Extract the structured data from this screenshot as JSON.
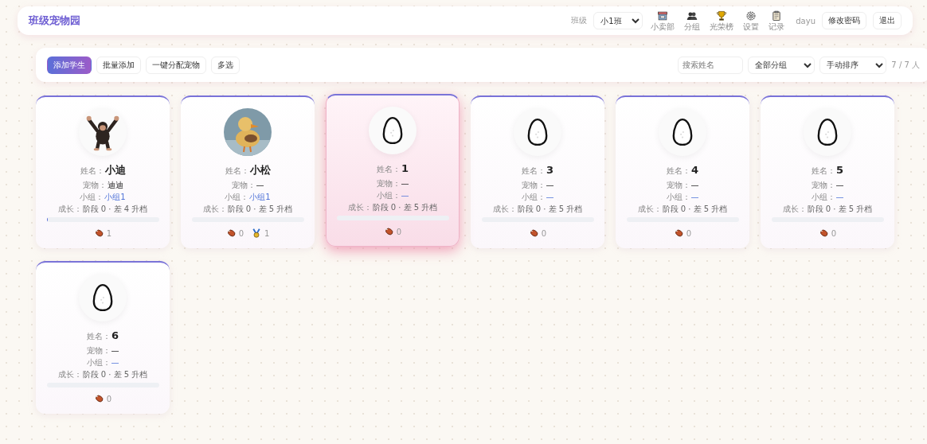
{
  "header": {
    "title": "班级宠物园",
    "class_label": "班级",
    "class_select": "小1班",
    "nav": [
      {
        "label": "小卖部",
        "kind": "store"
      },
      {
        "label": "分组",
        "kind": "people"
      },
      {
        "label": "光荣榜",
        "kind": "trophy"
      },
      {
        "label": "设置",
        "kind": "gear"
      },
      {
        "label": "记录",
        "kind": "clipboard"
      }
    ],
    "user": "dayu",
    "buttons": [
      "修改密码",
      "退出"
    ]
  },
  "toolbar": {
    "buttons": [
      {
        "label": "添加学生",
        "primary": true
      },
      {
        "label": "批量添加",
        "primary": false
      },
      {
        "label": "一键分配宠物",
        "primary": false
      },
      {
        "label": "多选",
        "primary": false
      }
    ],
    "search": {
      "placeholder": "搜索姓名"
    },
    "filters": [
      "全部分组",
      "手动排序"
    ],
    "count": "7 / 7 人"
  },
  "students": [
    {
      "avatar": {
        "kind": "chimp"
      },
      "hovered": false,
      "name": {
        "label": "姓名：",
        "value": "小迪"
      },
      "pet": {
        "label": "宠物：",
        "value": "迪迪"
      },
      "group": {
        "label": "小组：",
        "value": "小组1"
      },
      "growth": {
        "label": "成长：",
        "value": "阶段 0 · 差 4 升档"
      },
      "level": 0.01,
      "rewards": [
        {
          "kind": "meat",
          "count": "1"
        }
      ]
    },
    {
      "hovered": false,
      "name": {
        "label": "姓名：",
        "value": "小松"
      },
      "pet": {
        "label": "宠物：",
        "value": "—"
      },
      "group": {
        "label": "小组：",
        "value": "小组1"
      },
      "growth": {
        "label": "成长：",
        "value": "阶段 0 · 差 5 升档"
      },
      "level": 0,
      "rewards": [
        {
          "kind": "meat",
          "count": "0"
        },
        {
          "kind": "medal",
          "count": "1"
        }
      ]
    },
    {
      "avatar": {
        "kind": "egg"
      },
      "hovered": true,
      "name": {
        "label": "姓名：",
        "value": "1"
      },
      "pet": {
        "label": "宠物：",
        "value": "—"
      },
      "group": {
        "label": "小组：",
        "value": "—"
      },
      "growth": {
        "label": "成长：",
        "value": "阶段 0 · 差 5 升档"
      },
      "level": 0,
      "rewards": [
        {
          "kind": "meat",
          "count": "0"
        }
      ]
    },
    {
      "avatar": {
        "kind": "egg"
      },
      "hovered": false,
      "name": {
        "label": "姓名：",
        "value": "3"
      },
      "pet": {
        "label": "宠物：",
        "value": "—"
      },
      "group": {
        "label": "小组：",
        "value": "—"
      },
      "growth": {
        "label": "成长：",
        "value": "阶段 0 · 差 5 升档"
      },
      "level": 0,
      "rewards": [
        {
          "kind": "meat",
          "count": "0"
        }
      ]
    },
    {
      "avatar": {
        "kind": "egg"
      },
      "hovered": false,
      "name": {
        "label": "姓名：",
        "value": "4"
      },
      "pet": {
        "label": "宠物：",
        "value": "—"
      },
      "group": {
        "label": "小组：",
        "value": "—"
      },
      "growth": {
        "label": "成长：",
        "value": "阶段 0 · 差 5 升档"
      },
      "level": 0,
      "rewards": [
        {
          "kind": "meat",
          "count": "0"
        }
      ]
    },
    {
      "avatar": {
        "kind": "egg"
      },
      "hovered": false,
      "name": {
        "label": "姓名：",
        "value": "5"
      },
      "pet": {
        "label": "宠物：",
        "value": "—"
      },
      "group": {
        "label": "小组：",
        "value": "—"
      },
      "growth": {
        "label": "成长：",
        "value": "阶段 0 · 差 5 升档"
      },
      "level": 0,
      "rewards": [
        {
          "kind": "meat",
          "count": "0"
        }
      ]
    },
    {
      "avatar": {
        "kind": "egg"
      },
      "hovered": false,
      "name": {
        "label": "姓名：",
        "value": "6"
      },
      "pet": {
        "label": "宠物：",
        "value": "—"
      },
      "group": {
        "label": "小组：",
        "value": "—"
      },
      "growth": {
        "label": "成长：",
        "value": "阶段 0 · 差 5 升档"
      },
      "level": 0,
      "rewards": [
        {
          "kind": "meat",
          "count": "0"
        }
      ]
    }
  ]
}
